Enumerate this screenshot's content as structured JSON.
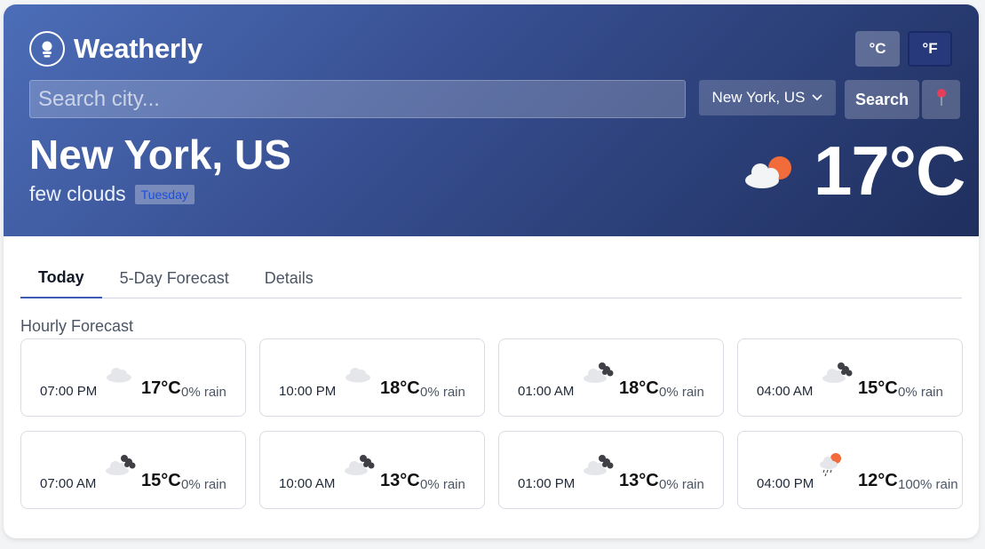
{
  "app": {
    "name": "Weatherly"
  },
  "units": {
    "celsius": "°C",
    "fahrenheit": "°F",
    "active": "°F"
  },
  "search": {
    "placeholder": "Search city...",
    "button": "Search"
  },
  "city_select": {
    "value": "New York, US"
  },
  "current": {
    "city": "New York, US",
    "condition": "few clouds",
    "day": "Tuesday",
    "temp": "17°C",
    "icon": "few-clouds-icon"
  },
  "tabs": [
    {
      "label": "Today",
      "active": true
    },
    {
      "label": "5-Day Forecast",
      "active": false
    },
    {
      "label": "Details",
      "active": false
    }
  ],
  "hourly": {
    "title": "Hourly Forecast",
    "items": [
      {
        "time": "07:00 PM",
        "temp": "17°C",
        "rain": "0% rain",
        "icon": "light-cloud"
      },
      {
        "time": "10:00 PM",
        "temp": "18°C",
        "rain": "0% rain",
        "icon": "light-cloud"
      },
      {
        "time": "01:00 AM",
        "temp": "18°C",
        "rain": "0% rain",
        "icon": "broken-clouds"
      },
      {
        "time": "04:00 AM",
        "temp": "15°C",
        "rain": "0% rain",
        "icon": "broken-clouds"
      },
      {
        "time": "07:00 AM",
        "temp": "15°C",
        "rain": "0% rain",
        "icon": "broken-clouds"
      },
      {
        "time": "10:00 AM",
        "temp": "13°C",
        "rain": "0% rain",
        "icon": "broken-clouds"
      },
      {
        "time": "01:00 PM",
        "temp": "13°C",
        "rain": "0% rain",
        "icon": "broken-clouds"
      },
      {
        "time": "04:00 PM",
        "temp": "12°C",
        "rain": "100% rain",
        "icon": "rain-sun"
      }
    ]
  },
  "colors": {
    "header_start": "#4c6db8",
    "header_end": "#1f2f5e",
    "tab_accent": "#3b5bb5",
    "badge_text": "#1d4ed8",
    "sun": "#f26b3a"
  }
}
